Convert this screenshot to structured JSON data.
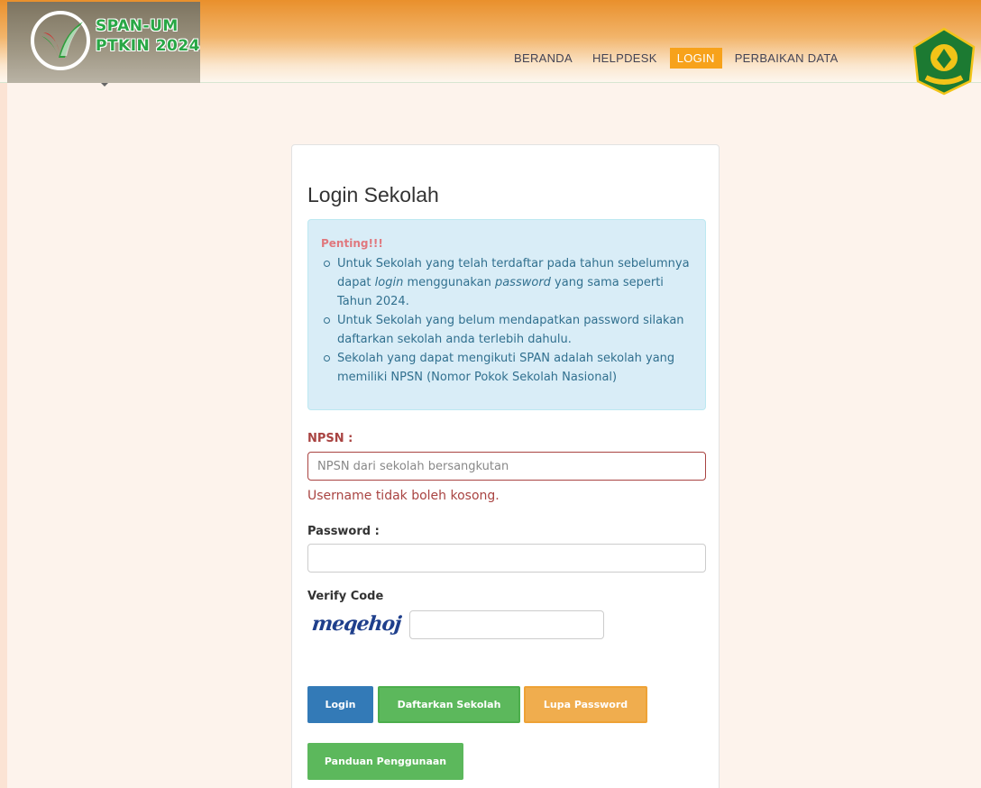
{
  "header": {
    "logo_line1": "SPAN-UM",
    "logo_line2": "PTKIN 2024",
    "nav": [
      {
        "label": "BERANDA",
        "active": false
      },
      {
        "label": "HELPDESK",
        "active": false
      },
      {
        "label": "LOGIN",
        "active": true
      },
      {
        "label": "PERBAIKAN DATA",
        "active": false
      }
    ],
    "kemenag_logo_text": "KEMENTERIAN AGAMA"
  },
  "login": {
    "title": "Login Sekolah",
    "alert": {
      "title": "Penting!!!",
      "item1_a": "Untuk Sekolah yang telah terdaftar pada tahun sebelumnya dapat ",
      "item1_b": "login",
      "item1_c": " menggunakan ",
      "item1_d": "password",
      "item1_e": " yang sama seperti Tahun 2024.",
      "item2": "Untuk Sekolah yang belum mendapatkan password silakan daftarkan sekolah anda terlebih dahulu.",
      "item3": "Sekolah yang dapat mengikuti SPAN adalah sekolah yang memiliki NPSN (Nomor Pokok Sekolah Nasional)"
    },
    "npsn_label": "NPSN :",
    "npsn_placeholder": "NPSN dari sekolah bersangkutan",
    "npsn_error": "Username tidak boleh kosong.",
    "password_label": "Password :",
    "verify_label": "Verify Code",
    "captcha_text": "meqehoj",
    "buttons": {
      "login": "Login",
      "register": "Daftarkan Sekolah",
      "forgot": "Lupa Password",
      "guide": "Panduan Penggunaan"
    }
  },
  "colors": {
    "header_orange": "#e9902c",
    "active_nav": "#f7a21b",
    "error": "#a94442",
    "primary": "#337ab7",
    "success": "#5cb85c",
    "warning": "#f0ad4e"
  }
}
